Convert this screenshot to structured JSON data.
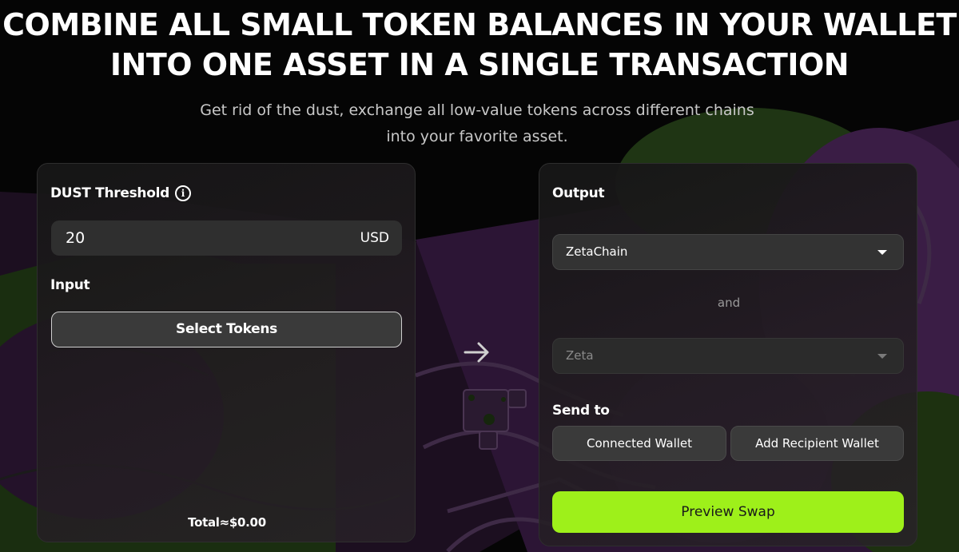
{
  "hero": {
    "title_line1": "COMBINE ALL SMALL TOKEN BALANCES IN YOUR WALLET",
    "title_line2": "INTO ONE ASSET IN A SINGLE TRANSACTION",
    "subtitle": "Get rid of the dust, exchange all low-value tokens across different chains into your favorite asset."
  },
  "input_panel": {
    "threshold_label": "DUST Threshold",
    "threshold_value": "20",
    "threshold_unit": "USD",
    "input_label": "Input",
    "select_tokens_label": "Select Tokens",
    "total_text": "Total≈$0.00"
  },
  "output_panel": {
    "output_label": "Output",
    "chain_selected": "ZetaChain",
    "and_text": "and",
    "token_placeholder": "Zeta",
    "send_to_label": "Send to",
    "connected_wallet_label": "Connected Wallet",
    "add_recipient_label": "Add Recipient Wallet",
    "preview_swap_label": "Preview Swap"
  },
  "colors": {
    "accent": "#9ef01a",
    "background": "#050505",
    "art_purple": "#3b1c43",
    "art_green": "#1e3312"
  },
  "icons": {
    "info": "info-icon",
    "arrow": "arrow-right-icon",
    "caret": "chevron-down-icon"
  }
}
